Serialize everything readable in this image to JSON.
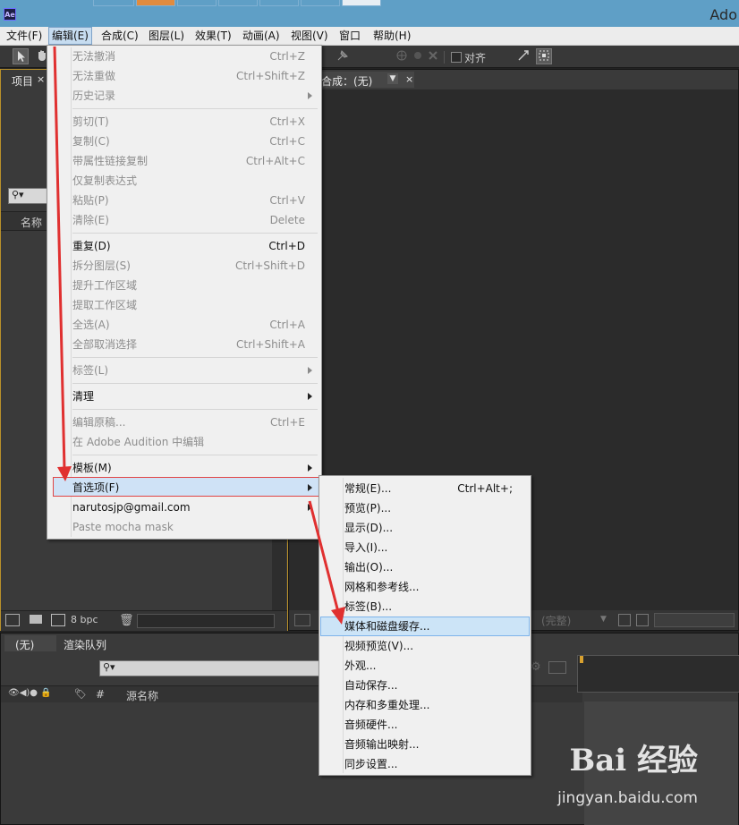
{
  "app": {
    "icon_text": "Ae",
    "title": "Ado"
  },
  "menubar": [
    {
      "label": "文件(F)",
      "active": false
    },
    {
      "label": "编辑(E)",
      "active": true
    },
    {
      "label": "合成(C)",
      "active": false
    },
    {
      "label": "图层(L)",
      "active": false
    },
    {
      "label": "效果(T)",
      "active": false
    },
    {
      "label": "动画(A)",
      "active": false
    },
    {
      "label": "视图(V)",
      "active": false
    },
    {
      "label": "窗口",
      "active": false
    },
    {
      "label": "帮助(H)",
      "active": false
    }
  ],
  "toolbar": {
    "align_label": "对齐"
  },
  "project_panel": {
    "tab": "项目",
    "close": "×",
    "col_name": "名称",
    "bpc": "8 bpc"
  },
  "comp_panel": {
    "tab": "合成：(无)",
    "close": "×",
    "zoom_value": "(完整)"
  },
  "timeline_panel": {
    "tab_none": "(无)",
    "tab_render": "渲染队列",
    "col_hash": "#",
    "col_source": "源名称"
  },
  "edit_menu": [
    {
      "label": "无法撤消",
      "shortcut": "Ctrl+Z",
      "enabled": false
    },
    {
      "label": "无法重做",
      "shortcut": "Ctrl+Shift+Z",
      "enabled": false
    },
    {
      "label": "历史记录",
      "shortcut": "",
      "enabled": false,
      "submenu": true
    },
    {
      "sep": true
    },
    {
      "label": "剪切(T)",
      "shortcut": "Ctrl+X",
      "enabled": false
    },
    {
      "label": "复制(C)",
      "shortcut": "Ctrl+C",
      "enabled": false
    },
    {
      "label": "带属性链接复制",
      "shortcut": "Ctrl+Alt+C",
      "enabled": false
    },
    {
      "label": "仅复制表达式",
      "shortcut": "",
      "enabled": false
    },
    {
      "label": "粘贴(P)",
      "shortcut": "Ctrl+V",
      "enabled": false
    },
    {
      "label": "清除(E)",
      "shortcut": "Delete",
      "enabled": false
    },
    {
      "sep": true
    },
    {
      "label": "重复(D)",
      "shortcut": "Ctrl+D",
      "enabled": true
    },
    {
      "label": "拆分图层(S)",
      "shortcut": "Ctrl+Shift+D",
      "enabled": false
    },
    {
      "label": "提升工作区域",
      "shortcut": "",
      "enabled": false
    },
    {
      "label": "提取工作区域",
      "shortcut": "",
      "enabled": false
    },
    {
      "label": "全选(A)",
      "shortcut": "Ctrl+A",
      "enabled": false
    },
    {
      "label": "全部取消选择",
      "shortcut": "Ctrl+Shift+A",
      "enabled": false
    },
    {
      "sep": true
    },
    {
      "label": "标签(L)",
      "shortcut": "",
      "enabled": false,
      "submenu": true
    },
    {
      "sep": true
    },
    {
      "label": "清理",
      "shortcut": "",
      "enabled": true,
      "submenu": true
    },
    {
      "sep": true
    },
    {
      "label": "编辑原稿...",
      "shortcut": "Ctrl+E",
      "enabled": false
    },
    {
      "label": "在 Adobe Audition 中编辑",
      "shortcut": "",
      "enabled": false
    },
    {
      "sep": true
    },
    {
      "label": "模板(M)",
      "shortcut": "",
      "enabled": true,
      "submenu": true
    },
    {
      "label": "首选项(F)",
      "shortcut": "",
      "enabled": true,
      "submenu": true,
      "highlighted": true
    },
    {
      "label": "narutosjp@gmail.com",
      "shortcut": "",
      "enabled": true,
      "submenu": true
    },
    {
      "label": "Paste mocha mask",
      "shortcut": "",
      "enabled": false
    }
  ],
  "prefs_submenu": [
    {
      "label": "常规(E)...",
      "shortcut": "Ctrl+Alt+;"
    },
    {
      "label": "预览(P)...",
      "shortcut": ""
    },
    {
      "label": "显示(D)...",
      "shortcut": ""
    },
    {
      "label": "导入(I)...",
      "shortcut": ""
    },
    {
      "label": "输出(O)...",
      "shortcut": ""
    },
    {
      "label": "网格和参考线...",
      "shortcut": ""
    },
    {
      "label": "标签(B)...",
      "shortcut": ""
    },
    {
      "label": "媒体和磁盘缓存...",
      "shortcut": "",
      "highlighted": true
    },
    {
      "label": "视频预览(V)...",
      "shortcut": ""
    },
    {
      "label": "外观...",
      "shortcut": ""
    },
    {
      "label": "自动保存...",
      "shortcut": ""
    },
    {
      "label": "内存和多重处理...",
      "shortcut": ""
    },
    {
      "label": "音频硬件...",
      "shortcut": ""
    },
    {
      "label": "音频输出映射...",
      "shortcut": ""
    },
    {
      "label": "同步设置...",
      "shortcut": ""
    }
  ],
  "watermark": {
    "logo": "Bai 经验",
    "url": "jingyan.baidu.com"
  },
  "colors": {
    "annotation_red": "#e03030",
    "menu_bg": "#f0f0f0",
    "highlight_blue": "#cce4f7"
  }
}
